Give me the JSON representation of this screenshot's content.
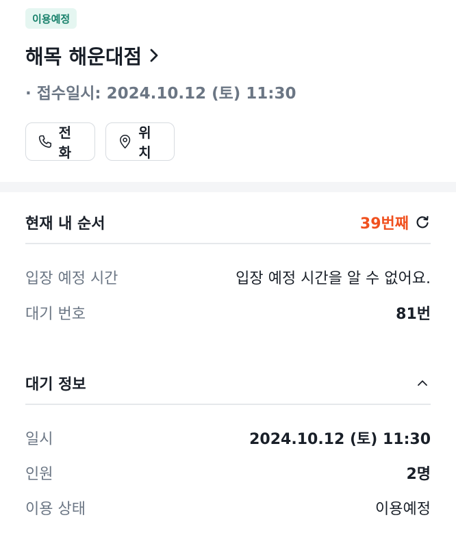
{
  "header": {
    "badge": "이용예정",
    "store_name": "해목 해운대점",
    "receipt_line": "· 접수일시: 2024.10.12 (토) 11:30",
    "call_label": "전화",
    "location_label": "위치"
  },
  "queue": {
    "title": "현재 내 순서",
    "position": "39번째",
    "rows": [
      {
        "label": "입장 예정 시간",
        "value": "입장 예정 시간을 알 수 없어요."
      },
      {
        "label": "대기 번호",
        "value": "81번"
      }
    ]
  },
  "wait_info": {
    "title": "대기 정보",
    "rows": [
      {
        "label": "일시",
        "value": "2024.10.12 (토) 11:30"
      },
      {
        "label": "인원",
        "value": "2명"
      },
      {
        "label": "이용 상태",
        "value": "이용예정"
      }
    ]
  },
  "colors": {
    "accent_orange": "#f0501e",
    "badge_bg": "#e5f6f1",
    "badge_text": "#17806a",
    "label_gray": "#6b7684"
  },
  "icons": [
    "chevron-right-icon",
    "phone-icon",
    "location-pin-icon",
    "refresh-icon",
    "chevron-up-icon"
  ]
}
